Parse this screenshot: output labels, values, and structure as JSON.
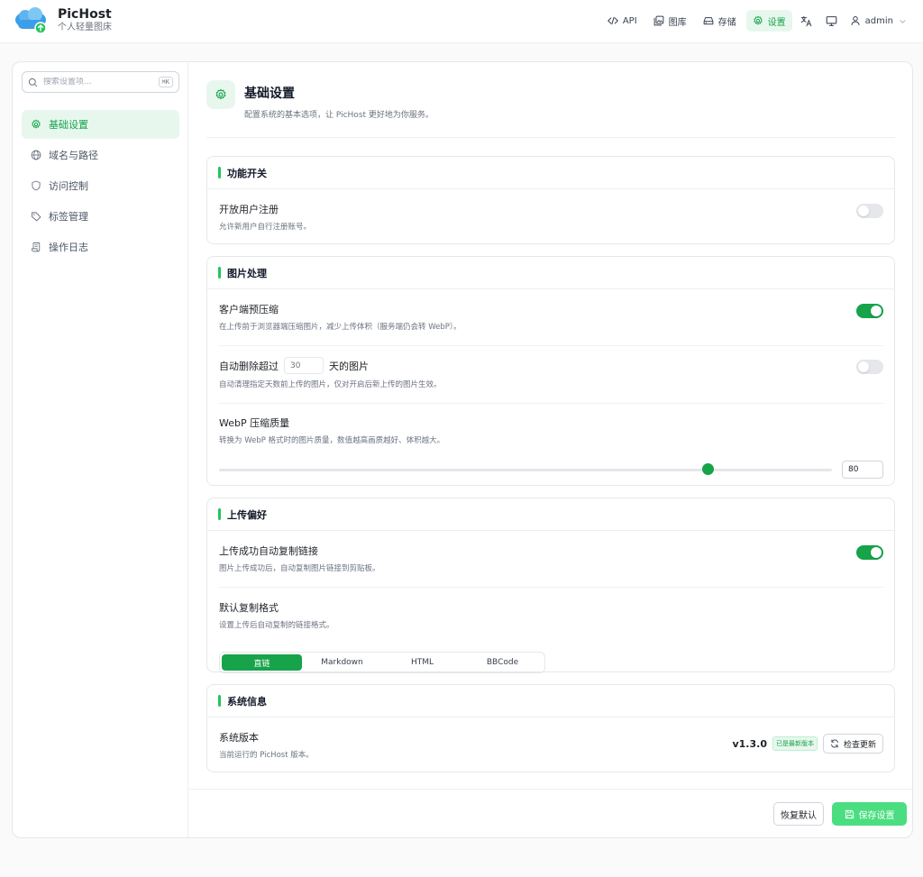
{
  "header": {
    "brand_name": "PicHost",
    "brand_sub": "个人轻量图床",
    "nav": [
      {
        "label": "API",
        "icon": "code-icon"
      },
      {
        "label": "图库",
        "icon": "gallery-icon"
      },
      {
        "label": "存储",
        "icon": "storage-icon"
      },
      {
        "label": "设置",
        "icon": "gear-icon"
      }
    ],
    "user": "admin"
  },
  "sidebar": {
    "search_placeholder": "搜索设置项...",
    "shortcut": "⌘K",
    "items": [
      {
        "label": "基础设置"
      },
      {
        "label": "域名与路径"
      },
      {
        "label": "访问控制"
      },
      {
        "label": "标签管理"
      },
      {
        "label": "操作日志"
      }
    ]
  },
  "page": {
    "title": "基础设置",
    "desc": "配置系统的基本选项，让 PicHost 更好地为你服务。"
  },
  "sections": {
    "features": {
      "title": "功能开关",
      "register_title": "开放用户注册",
      "register_desc": "允许新用户自行注册账号。",
      "register_on": false
    },
    "image": {
      "title": "图片处理",
      "compress_title": "客户端预压缩",
      "compress_desc": "在上传前于浏览器端压缩图片，减少上传体积（服务端仍会转 WebP）。",
      "compress_on": true,
      "autodel_prefix": "自动删除超过",
      "autodel_placeholder": "30",
      "autodel_suffix": "天的图片",
      "autodel_desc": "自动清理指定天数前上传的图片，仅对开启后新上传的图片生效。",
      "autodel_on": false,
      "quality_title": "WebP 压缩质量",
      "quality_desc": "转换为 WebP 格式时的图片质量，数值越高画质越好、体积越大。",
      "quality_value": "80",
      "quality_min": 1,
      "quality_max": 100
    },
    "upload": {
      "title": "上传偏好",
      "autocopy_title": "上传成功自动复制链接",
      "autocopy_desc": "图片上传成功后，自动复制图片链接到剪贴板。",
      "autocopy_on": true,
      "format_title": "默认复制格式",
      "format_desc": "设置上传后自动复制的链接格式。",
      "formats": [
        "直链",
        "Markdown",
        "HTML",
        "BBCode"
      ],
      "format_selected": 0
    },
    "system": {
      "title": "系统信息",
      "version_title": "系统版本",
      "version_desc": "当前运行的 PicHost 版本。",
      "version": "v1.3.0",
      "badge": "已是最新版本",
      "check_label": "检查更新"
    }
  },
  "footer": {
    "reset_label": "恢复默认",
    "save_label": "保存设置"
  },
  "colors": {
    "accent": "#16a34a",
    "accent_light": "#e8f7ee",
    "save_button": "#4ade80"
  }
}
